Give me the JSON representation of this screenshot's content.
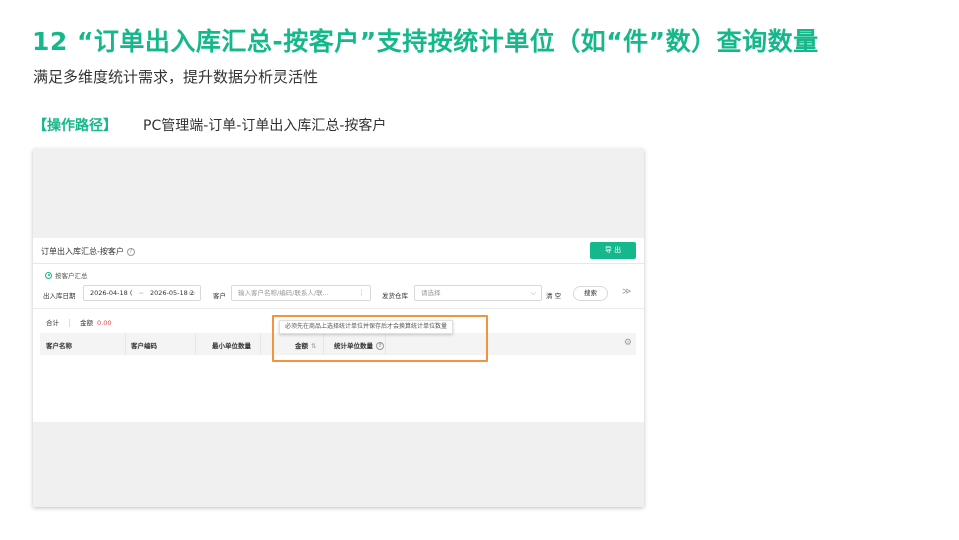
{
  "slide": {
    "title": "12 “订单出入库汇总-按客户”支持按统计单位（如“件”数）查询数量",
    "subtitle": "满足多维度统计需求，提升数据分析灵活性",
    "path_label": "【操作路径】",
    "path_value": "PC管理端-订单-订单出入库汇总-按客户"
  },
  "app": {
    "page_title": "订单出入库汇总-按客户",
    "help_icon": "?",
    "export_label": "导 出",
    "radio_label": "按客户汇总",
    "filters": {
      "date_label": "出入库日期",
      "date_start": "2026-04-18 (",
      "date_sep": "~",
      "date_end": "2026-05-18 2",
      "calendar_icon": "▭",
      "customer_label": "客户",
      "customer_placeholder": "输入客户名称/编码/联系人/联...",
      "customer_more_icon": "⋮",
      "warehouse_label": "发货仓库",
      "warehouse_placeholder": "请选择",
      "warehouse_arrow": "⌵",
      "clear_label": "清 空",
      "search_label": "搜索",
      "expand_icon": "≫"
    },
    "summary": {
      "total_label": "合计",
      "amount_label": "金额",
      "amount_value": "0.00"
    },
    "table": {
      "columns": [
        "客户名称",
        "客户编码",
        "最小单位数量",
        "金额",
        "统计单位数量"
      ],
      "sort_icon": "⇅",
      "help_icon": "?",
      "settings_icon": "⚙"
    },
    "tooltip": "必须先在商品上选择统计单位并保存后才会换算统计单位数量"
  },
  "colors": {
    "accent": "#14b88a",
    "highlight": "#f0953e",
    "amount": "#e64545"
  }
}
